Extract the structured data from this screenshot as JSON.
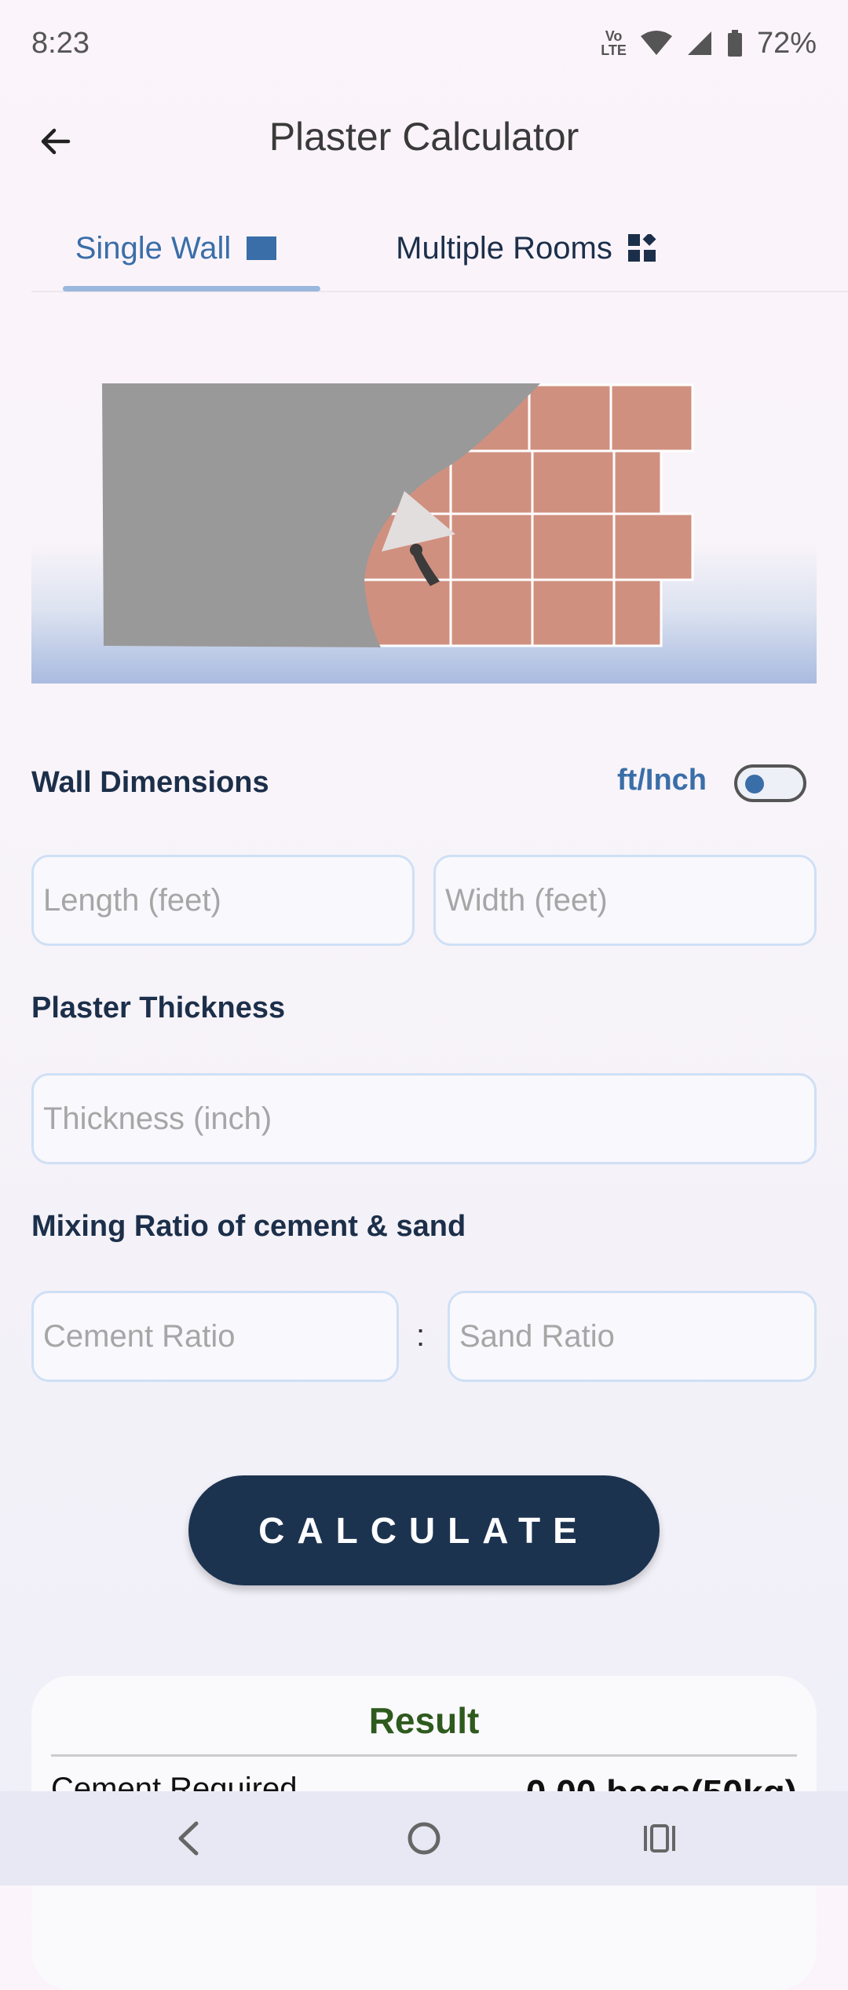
{
  "status_bar": {
    "time": "8:23",
    "battery": "72%",
    "network_label": "Vo LTE"
  },
  "header": {
    "title": "Plaster Calculator"
  },
  "tabs": [
    {
      "label": "Single Wall",
      "selected": true
    },
    {
      "label": "Multiple Rooms",
      "selected": false
    }
  ],
  "wall_dimensions": {
    "label": "Wall Dimensions",
    "unit_toggle_label": "ft/Inch",
    "toggle_on": false,
    "length_placeholder": "Length (feet)",
    "width_placeholder": "Width (feet)"
  },
  "plaster_thickness": {
    "label": "Plaster Thickness",
    "thickness_placeholder": "Thickness (inch)"
  },
  "mixing_ratio": {
    "label": "Mixing Ratio of cement & sand",
    "cement_placeholder": "Cement Ratio",
    "separator": ":",
    "sand_placeholder": "Sand Ratio"
  },
  "calculate_button": {
    "label": "CALCULATE"
  },
  "result": {
    "title": "Result",
    "rows": [
      {
        "label": "Cement Required",
        "value": "0.00 bags(50kg)"
      }
    ]
  },
  "colors": {
    "primary": "#1c3350",
    "accent": "#3a6ea8",
    "result_title": "#2e5a1e",
    "brick": "#d09080",
    "plaster": "#999999"
  }
}
